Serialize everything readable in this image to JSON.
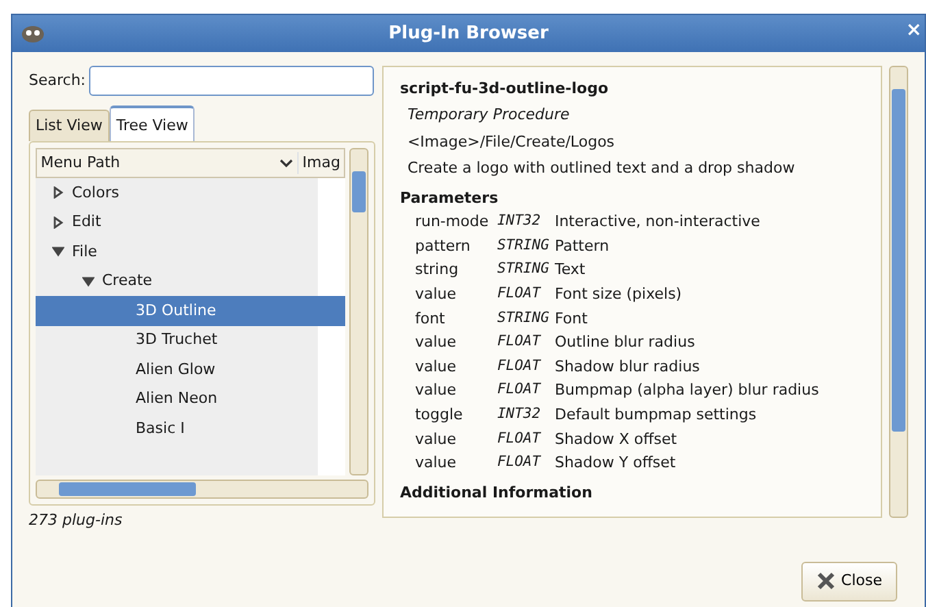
{
  "window": {
    "title": "Plug-In Browser",
    "close_glyph": "×"
  },
  "search": {
    "label": "Search:"
  },
  "tabs": [
    {
      "label": "List View",
      "selected": false
    },
    {
      "label": "Tree View",
      "selected": true
    }
  ],
  "tree": {
    "columns": [
      "Menu Path",
      "Imag"
    ],
    "items": [
      {
        "label": "Colors",
        "expanded": false,
        "selected": false
      },
      {
        "label": "Edit",
        "expanded": false,
        "selected": false
      },
      {
        "label": "File",
        "expanded": true,
        "selected": false,
        "children": [
          {
            "label": "Create",
            "expanded": true,
            "selected": false,
            "children": [
              {
                "label": "3D Outline",
                "selected": true
              },
              {
                "label": "3D Truchet",
                "selected": false
              },
              {
                "label": "Alien Glow",
                "selected": false
              },
              {
                "label": "Alien Neon",
                "selected": false
              },
              {
                "label": "Basic I",
                "selected": false
              }
            ]
          }
        ]
      }
    ]
  },
  "count": "273 plug-ins",
  "details": {
    "name": "script-fu-3d-outline-logo",
    "type": "Temporary Procedure",
    "menu_path": "<Image>/File/Create/Logos",
    "blurb": "Create a logo with outlined text and a drop shadow",
    "parameters_heading": "Parameters",
    "parameters": [
      {
        "name": "run-mode",
        "type": "INT32",
        "description": "Interactive, non-interactive"
      },
      {
        "name": "pattern",
        "type": "STRING",
        "description": "Pattern"
      },
      {
        "name": "string",
        "type": "STRING",
        "description": "Text"
      },
      {
        "name": "value",
        "type": "FLOAT",
        "description": "Font size (pixels)"
      },
      {
        "name": "font",
        "type": "STRING",
        "description": "Font"
      },
      {
        "name": "value",
        "type": "FLOAT",
        "description": "Outline blur radius"
      },
      {
        "name": "value",
        "type": "FLOAT",
        "description": "Shadow blur radius"
      },
      {
        "name": "value",
        "type": "FLOAT",
        "description": "Bumpmap (alpha layer) blur radius"
      },
      {
        "name": "toggle",
        "type": "INT32",
        "description": "Default bumpmap settings"
      },
      {
        "name": "value",
        "type": "FLOAT",
        "description": "Shadow X offset"
      },
      {
        "name": "value",
        "type": "FLOAT",
        "description": "Shadow Y offset"
      }
    ],
    "additional_heading": "Additional Information"
  },
  "buttons": [
    {
      "label": "Close"
    }
  ]
}
